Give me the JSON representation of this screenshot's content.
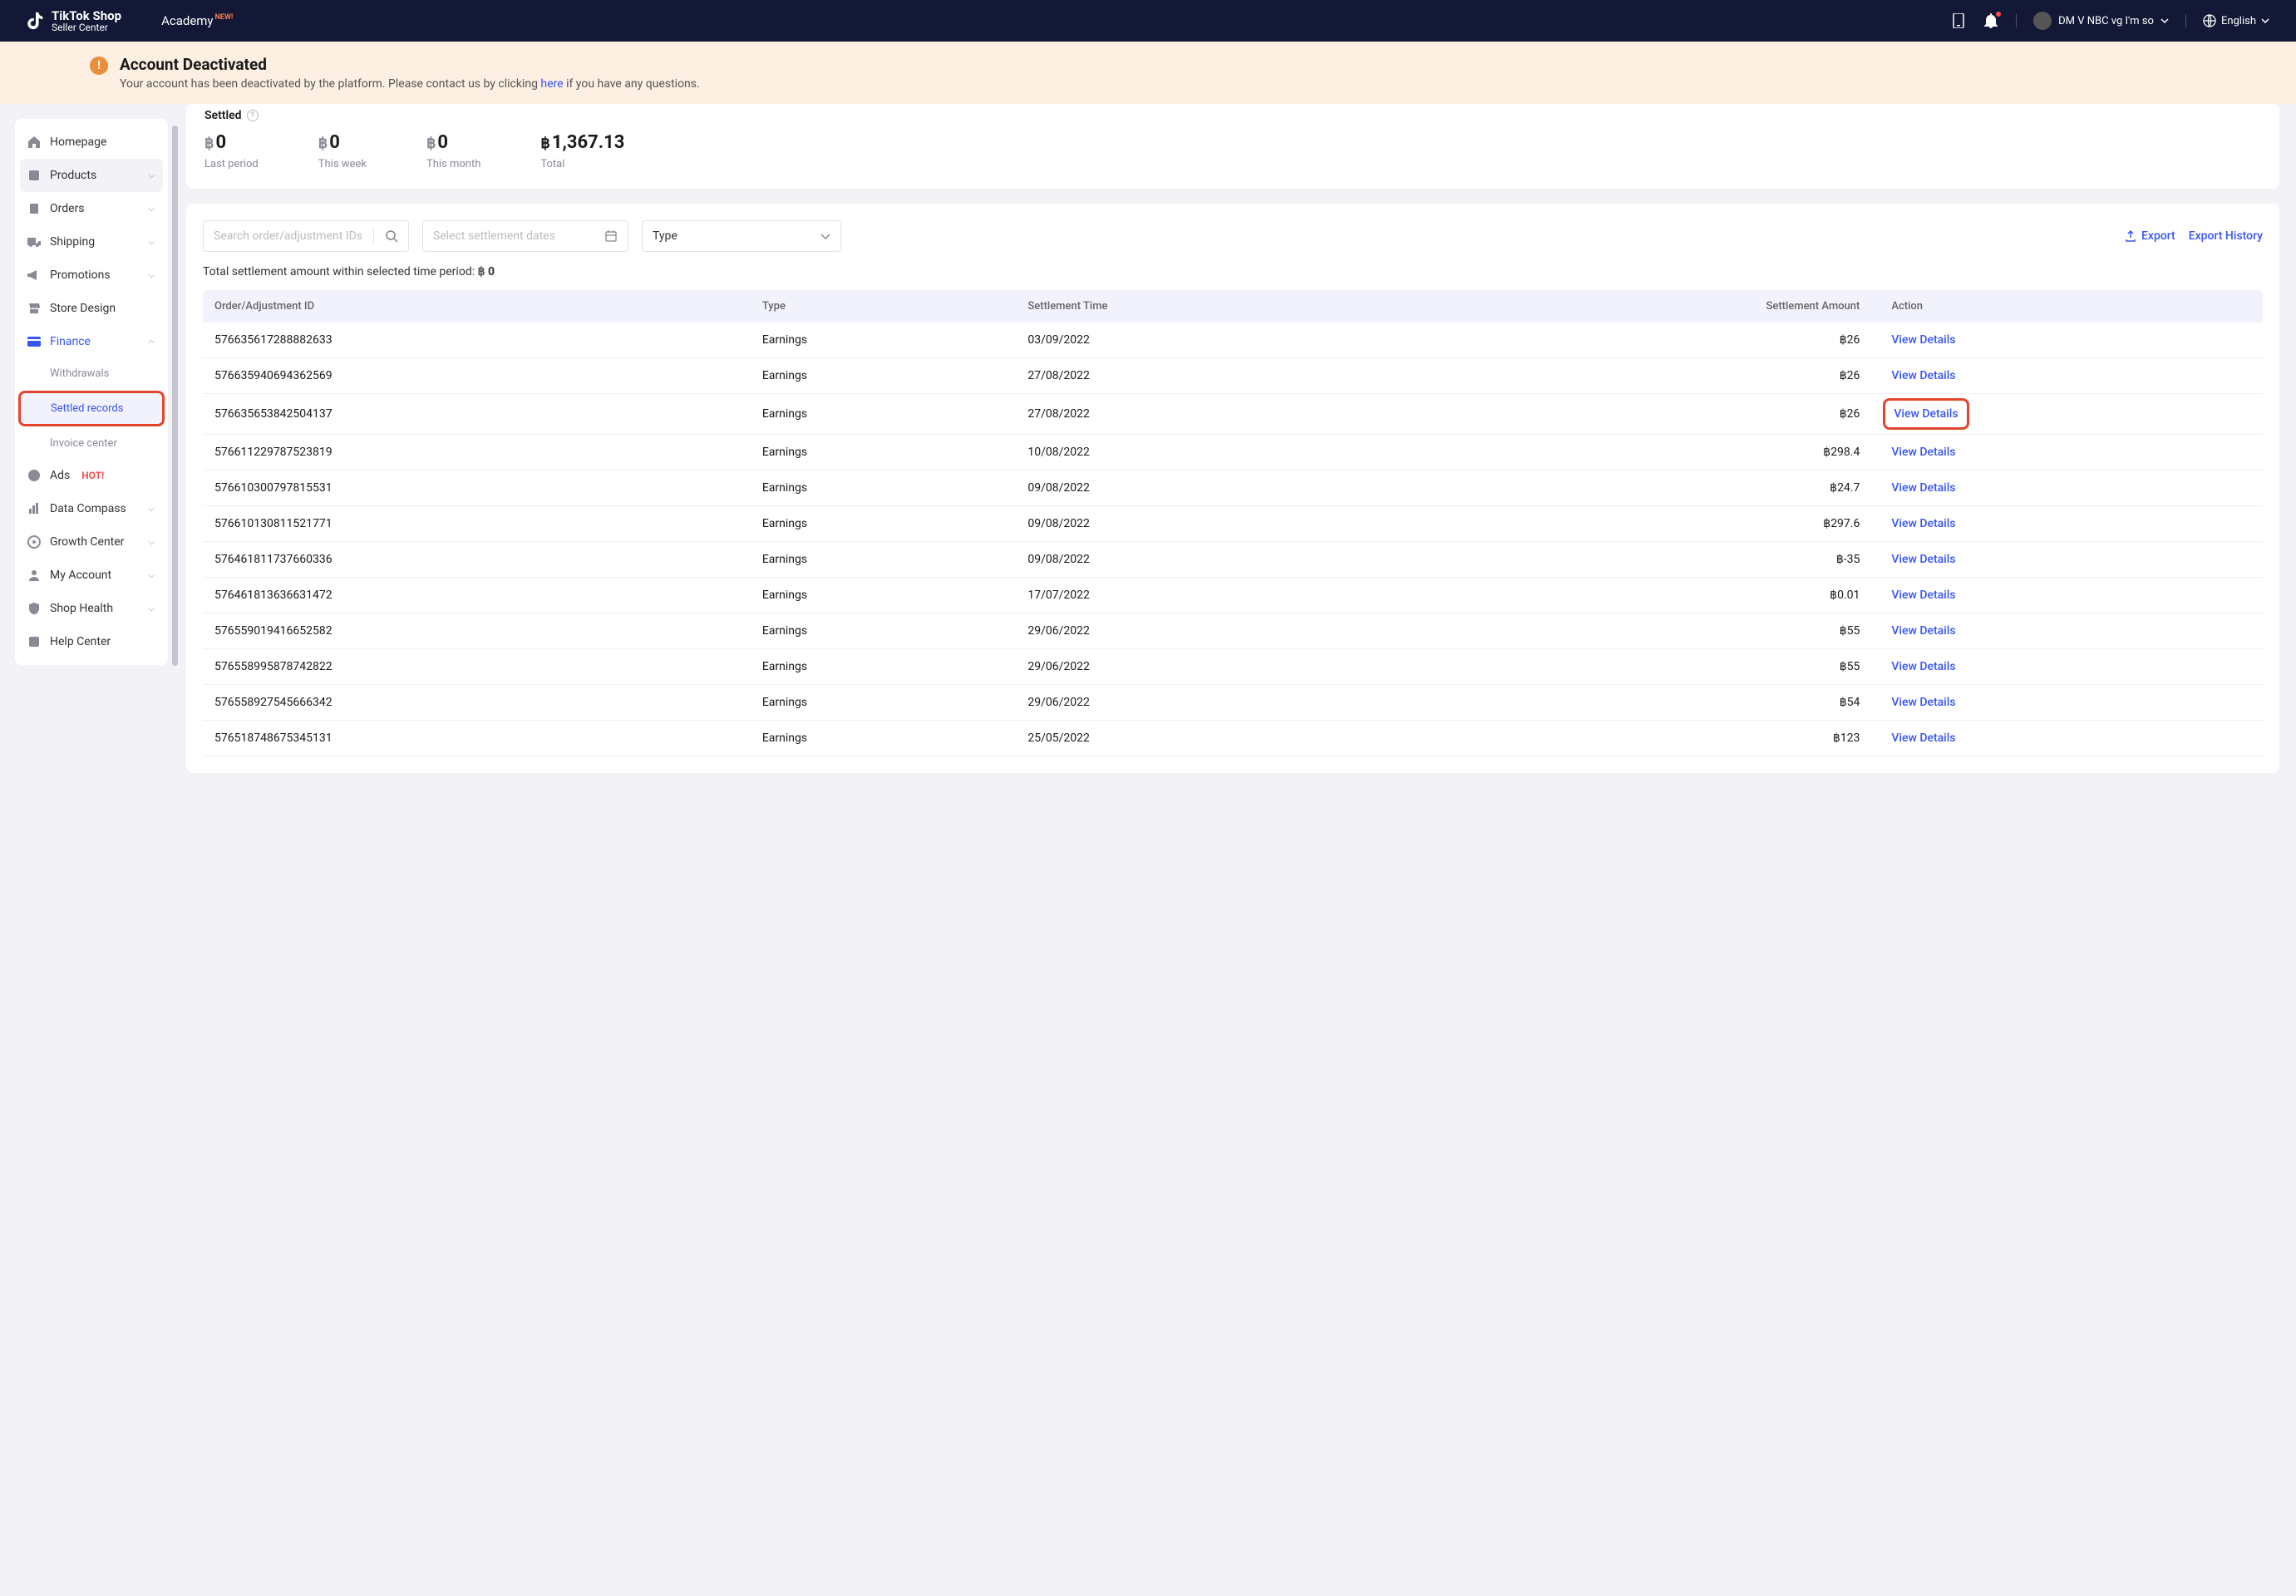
{
  "header": {
    "logo_line1": "TikTok Shop",
    "logo_line2": "Seller Center",
    "academy": "Academy",
    "academy_badge": "NEW!",
    "username": "DM V NBC vg I'm so",
    "language": "English"
  },
  "alert": {
    "title": "Account Deactivated",
    "text_before": "Your account has been deactivated by the platform. Please contact us by clicking ",
    "link": "here",
    "text_after": " if you have any questions."
  },
  "sidebar": {
    "homepage": "Homepage",
    "products": "Products",
    "orders": "Orders",
    "shipping": "Shipping",
    "promotions": "Promotions",
    "store_design": "Store Design",
    "finance": "Finance",
    "withdrawals": "Withdrawals",
    "settled_records": "Settled records",
    "invoice_center": "Invoice center",
    "ads": "Ads",
    "ads_badge": "HOT!",
    "data_compass": "Data Compass",
    "growth_center": "Growth Center",
    "my_account": "My Account",
    "shop_health": "Shop Health",
    "help_center": "Help Center"
  },
  "summary": {
    "head": "Settled",
    "currency": "฿",
    "last_period_val": "0",
    "last_period_label": "Last period",
    "this_week_val": "0",
    "this_week_label": "This week",
    "this_month_val": "0",
    "this_month_label": "This month",
    "total_val": "1,367.13",
    "total_label": "Total"
  },
  "controls": {
    "search_placeholder": "Search order/adjustment IDs",
    "date_placeholder": "Select settlement dates",
    "type_placeholder": "Type",
    "export": "Export",
    "export_history": "Export History"
  },
  "period_total": {
    "label": "Total settlement amount within selected time period: ",
    "currency": "฿",
    "value": "0"
  },
  "table": {
    "headers": {
      "id": "Order/Adjustment ID",
      "type": "Type",
      "time": "Settlement Time",
      "amount": "Settlement Amount",
      "action": "Action"
    },
    "action_label": "View Details",
    "rows": [
      {
        "id": "576635617288882633",
        "type": "Earnings",
        "time": "03/09/2022",
        "amount": "฿26",
        "highlight": false
      },
      {
        "id": "576635940694362569",
        "type": "Earnings",
        "time": "27/08/2022",
        "amount": "฿26",
        "highlight": false
      },
      {
        "id": "576635653842504137",
        "type": "Earnings",
        "time": "27/08/2022",
        "amount": "฿26",
        "highlight": true
      },
      {
        "id": "576611229787523819",
        "type": "Earnings",
        "time": "10/08/2022",
        "amount": "฿298.4",
        "highlight": false
      },
      {
        "id": "576610300797815531",
        "type": "Earnings",
        "time": "09/08/2022",
        "amount": "฿24.7",
        "highlight": false
      },
      {
        "id": "576610130811521771",
        "type": "Earnings",
        "time": "09/08/2022",
        "amount": "฿297.6",
        "highlight": false
      },
      {
        "id": "576461811737660336",
        "type": "Earnings",
        "time": "09/08/2022",
        "amount": "฿-35",
        "highlight": false
      },
      {
        "id": "576461813636631472",
        "type": "Earnings",
        "time": "17/07/2022",
        "amount": "฿0.01",
        "highlight": false
      },
      {
        "id": "576559019416652582",
        "type": "Earnings",
        "time": "29/06/2022",
        "amount": "฿55",
        "highlight": false
      },
      {
        "id": "576558995878742822",
        "type": "Earnings",
        "time": "29/06/2022",
        "amount": "฿55",
        "highlight": false
      },
      {
        "id": "576558927545666342",
        "type": "Earnings",
        "time": "29/06/2022",
        "amount": "฿54",
        "highlight": false
      },
      {
        "id": "576518748675345131",
        "type": "Earnings",
        "time": "25/05/2022",
        "amount": "฿123",
        "highlight": false
      }
    ]
  }
}
